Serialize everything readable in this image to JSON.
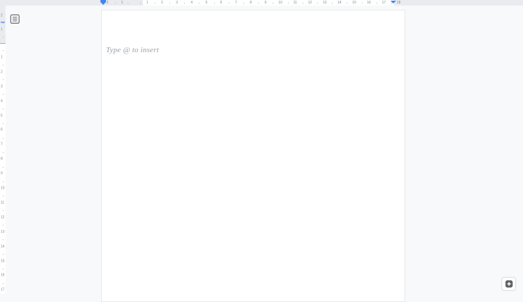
{
  "editor": {
    "placeholder": "Type @ to insert"
  },
  "horizontal_ruler": {
    "margin_labels": [
      "2",
      "1"
    ],
    "labels": [
      "1",
      "2",
      "3",
      "4",
      "5",
      "6",
      "7",
      "8",
      "9",
      "10",
      "11",
      "12",
      "13",
      "14",
      "15",
      "16",
      "17",
      "18"
    ]
  },
  "vertical_ruler": {
    "margin_labels": [
      "2",
      "1"
    ],
    "labels": [
      "1",
      "2",
      "3",
      "4",
      "5",
      "6",
      "7",
      "8",
      "9",
      "10",
      "11",
      "12",
      "13",
      "14",
      "15",
      "16",
      "17"
    ]
  },
  "icons": {
    "outline": "document-outline-icon",
    "corner": "plus-square-icon"
  },
  "colors": {
    "background": "#F8F9FA",
    "ruler_background": "#E9EBEE",
    "ruler_active": "#FFFFFF",
    "ruler_label": "#85898E",
    "indent_marker": "#4285F4",
    "page_background": "#FFFFFF",
    "page_border": "#E7E9EC",
    "placeholder_text": "#9AA0A6",
    "icon_gray": "#5F6368"
  }
}
